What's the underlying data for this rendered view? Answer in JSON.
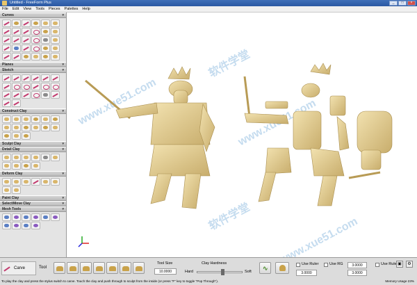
{
  "window": {
    "title": "Untitled - FreeForm Plus"
  },
  "menu": [
    "File",
    "Edit",
    "View",
    "Tools",
    "Pieces",
    "Palettes",
    "Help"
  ],
  "palette": {
    "sections": [
      {
        "label": "Curves",
        "rows": 6
      },
      {
        "label": "Planes",
        "rows": 0
      },
      {
        "label": "Sketch",
        "rows": 4
      },
      {
        "label": "Construct Clay",
        "rows": 3
      },
      {
        "label": "Sculpt Clay",
        "rows": 0
      },
      {
        "label": "Detail Clay",
        "rows": 2
      },
      {
        "label": "Deform Clay",
        "rows": 2
      },
      {
        "label": "Paint Clay",
        "rows": 0
      },
      {
        "label": "Select/Move Clay",
        "rows": 0
      },
      {
        "label": "Mesh Tools",
        "rows": 2
      }
    ]
  },
  "watermarks": [
    "软件学堂",
    "www.xue51.com",
    "软件学堂",
    "www.xue51.com",
    "软件学堂",
    "www.xue51.com"
  ],
  "status": {
    "current_tool": "Carve",
    "tools_label": "Tool",
    "tool_size_label": "Tool Size",
    "tool_size_value": "10.0000",
    "clay_hardness_label": "Clay Hardness",
    "hard_label": "Hard",
    "soft_label": "Soft",
    "use_ruler_label": "Use Ruler",
    "use_ruler_value": "3.0000",
    "use_ruler2_label": "Use Ruler",
    "use_ruler2_value": "3.0000",
    "use_ruler3_value": "3.0000",
    "use_rg_label": "Use RG",
    "hint": "To play the clay and press the stylus switch to carve. Touch the clay and push through to sculpt from the inside (or press \"F\" key to toggle \"Pop Through\").",
    "memory": "Memory Usage 23%"
  }
}
